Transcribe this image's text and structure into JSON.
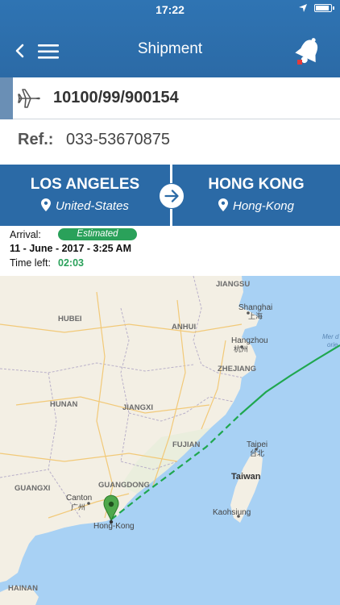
{
  "status": {
    "time": "17:22"
  },
  "header": {
    "title": "Shipment"
  },
  "shipment": {
    "number": "10100/99/900154",
    "ref_label": "Ref.:",
    "ref_value": "033-53670875"
  },
  "route": {
    "origin_city": "LOS ANGELES",
    "origin_country": "United-States",
    "destination_city": "HONG KONG",
    "destination_country": "Hong-Kong"
  },
  "arrival": {
    "label": "Arrival:",
    "status": "Estimated",
    "date": "11 - June - 2017 - 3:25 AM",
    "time_left_label": "Time left:",
    "time_left_value": "02:03"
  },
  "map": {
    "labels": {
      "jiangsu": "JIANGSU",
      "shanghai": "Shanghai",
      "shanghai_cn": "上海",
      "hubei": "HUBEI",
      "anhui": "ANHUI",
      "hangzhou": "Hangzhou",
      "hangzhou_cn": "杭州",
      "zhejiang": "ZHEJIANG",
      "hunan": "HUNAN",
      "jiangxi": "JIANGXI",
      "fujian": "FUJIAN",
      "taipei": "Taipei",
      "taipei_cn": "台北",
      "taiwan": "Taiwan",
      "guangxi": "GUANGXI",
      "guangdong": "GUANGDONG",
      "canton": "Canton",
      "canton_cn": "广州",
      "kaohsiung": "Kaohsiung",
      "hongkong": "Hong-Kong",
      "hainan": "HAINAN",
      "sea1": "Mer d",
      "sea2": "orie"
    },
    "colors": {
      "land": "#f3efe4",
      "water": "#a8d1f4",
      "route": "#1fa74f",
      "marker": "#4fa84c"
    }
  }
}
